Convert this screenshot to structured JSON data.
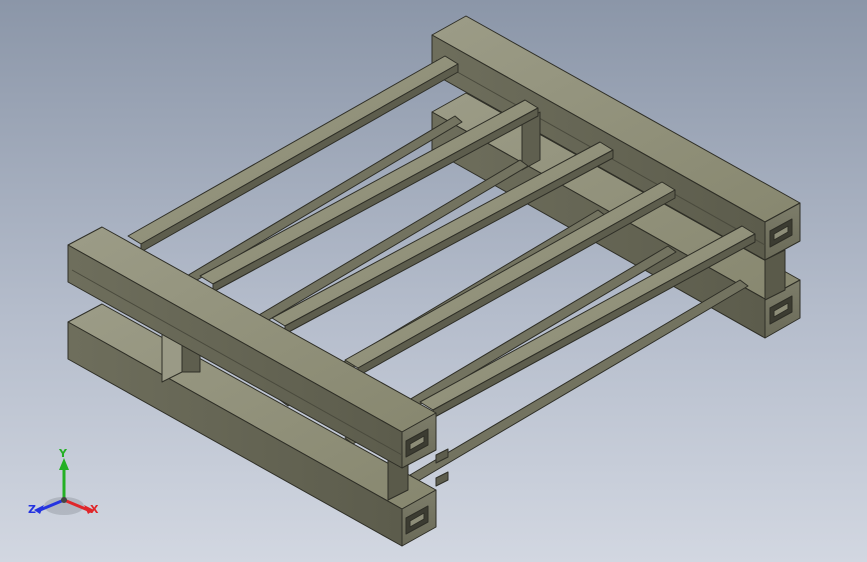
{
  "view": {
    "background_top": "#8b96a8",
    "background_bottom": "#d2d7e1",
    "model_color": "#7a7a68",
    "edge_color": "#2f2f27"
  },
  "triad": {
    "x_label": "X",
    "y_label": "Y",
    "z_label": "Z",
    "x_color": "#e0262a",
    "y_color": "#24b024",
    "z_color": "#2433e0"
  }
}
